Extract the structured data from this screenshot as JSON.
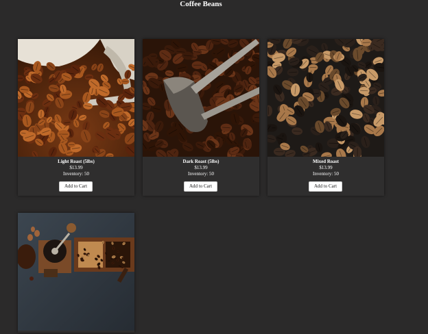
{
  "page": {
    "title": "Coffee Beans",
    "background": "#2b2a2a"
  },
  "products": [
    {
      "name": "Light Roast (5lbs)",
      "price": "$13.99",
      "inventory": "Inventory: 50",
      "button": "Add to Cart",
      "image": "light-roast-beans-in-cup"
    },
    {
      "name": "Dark Roast (5lbs)",
      "price": "$13.99",
      "inventory": "Inventory: 50",
      "button": "Add to Cart",
      "image": "dark-roast-beans-with-scoop"
    },
    {
      "name": "Mixed Roast",
      "price": "$13.99",
      "inventory": "Inventory: 50",
      "button": "Add to Cart",
      "image": "mixed-roast-beans"
    },
    {
      "image": "coffee-grinder-and-bean-boxes"
    }
  ]
}
